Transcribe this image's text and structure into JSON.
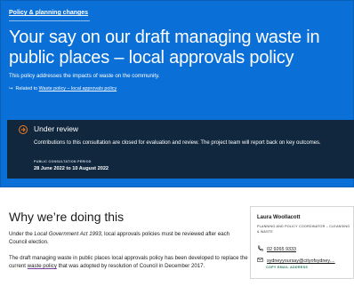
{
  "breadcrumb": {
    "label": "Policy & planning changes"
  },
  "hero": {
    "title": "Your say on our draft managing waste in public places – local approvals policy",
    "intro": "This policy addresses the impacts of waste on the community.",
    "related_prefix": "Related to",
    "related_link": "Waste policy – local approvals policy"
  },
  "status": {
    "title": "Under review",
    "body": "Contributions to this consultation are closed for evaluation and review. The project team will report back on key outcomes.",
    "period_label": "PUBLIC CONSULTATION PERIOD",
    "period_value": "28 June 2022 to 10 August 2022",
    "accent_color": "#f07a21"
  },
  "why": {
    "title": "Why we’re doing this",
    "p1_pre": "Under the ",
    "p1_em": "Local Government Act 1993",
    "p1_post": ", local approvals policies must be reviewed after each Council election.",
    "p2_pre": "The draft managing waste in public places local approvals policy has been developed to replace the current ",
    "p2_link": "waste policy",
    "p2_post": " that was adopted by resolution of Council in December 2017."
  },
  "contact": {
    "name": "Laura Woollacott",
    "role": "PLANNING AND POLICY COORDINATOR – CLEANSING & WASTE",
    "phone": "02 9265 9333",
    "email": "sydneyyoursay@cityofsydney....",
    "copy_label": "COPY EMAIL ADDRESS",
    "phone_icon": "phone-icon",
    "email_icon": "mail-icon"
  },
  "colors": {
    "hero": "#0a6fd6",
    "status_panel": "#10273d",
    "copy_label": "#2b7a5b"
  }
}
